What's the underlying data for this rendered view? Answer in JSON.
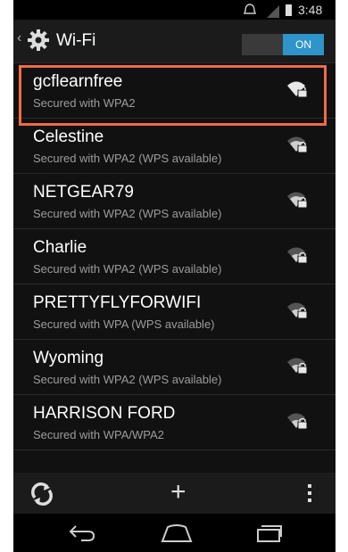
{
  "status": {
    "time": "3:48"
  },
  "header": {
    "title": "Wi-Fi",
    "toggle_label": "ON"
  },
  "networks": [
    {
      "ssid": "gcflearnfree",
      "security": "Secured with WPA2"
    },
    {
      "ssid": "Celestine",
      "security": "Secured with WPA2 (WPS available)"
    },
    {
      "ssid": "NETGEAR79",
      "security": "Secured with WPA2 (WPS available)"
    },
    {
      "ssid": "Charlie",
      "security": "Secured with WPA2 (WPS available)"
    },
    {
      "ssid": "PRETTYFLYFORWIFI",
      "security": "Secured with WPA (WPS available)"
    },
    {
      "ssid": "Wyoming",
      "security": "Secured with WPA2 (WPS available)"
    },
    {
      "ssid": "HARRISON FORD",
      "security": "Secured with WPA/WPA2"
    }
  ],
  "colors": {
    "accent": "#2e94c9",
    "highlight": "#f26a48"
  },
  "icons": {
    "status": [
      "alarm-icon",
      "signal-icon",
      "battery-icon"
    ],
    "header": [
      "back-chevron-icon",
      "settings-gear-icon"
    ],
    "network": "wifi-locked-icon",
    "toolbar": [
      "refresh-icon",
      "add-icon",
      "overflow-menu-icon"
    ],
    "nav": [
      "nav-back-icon",
      "nav-home-icon",
      "nav-recents-icon"
    ]
  }
}
